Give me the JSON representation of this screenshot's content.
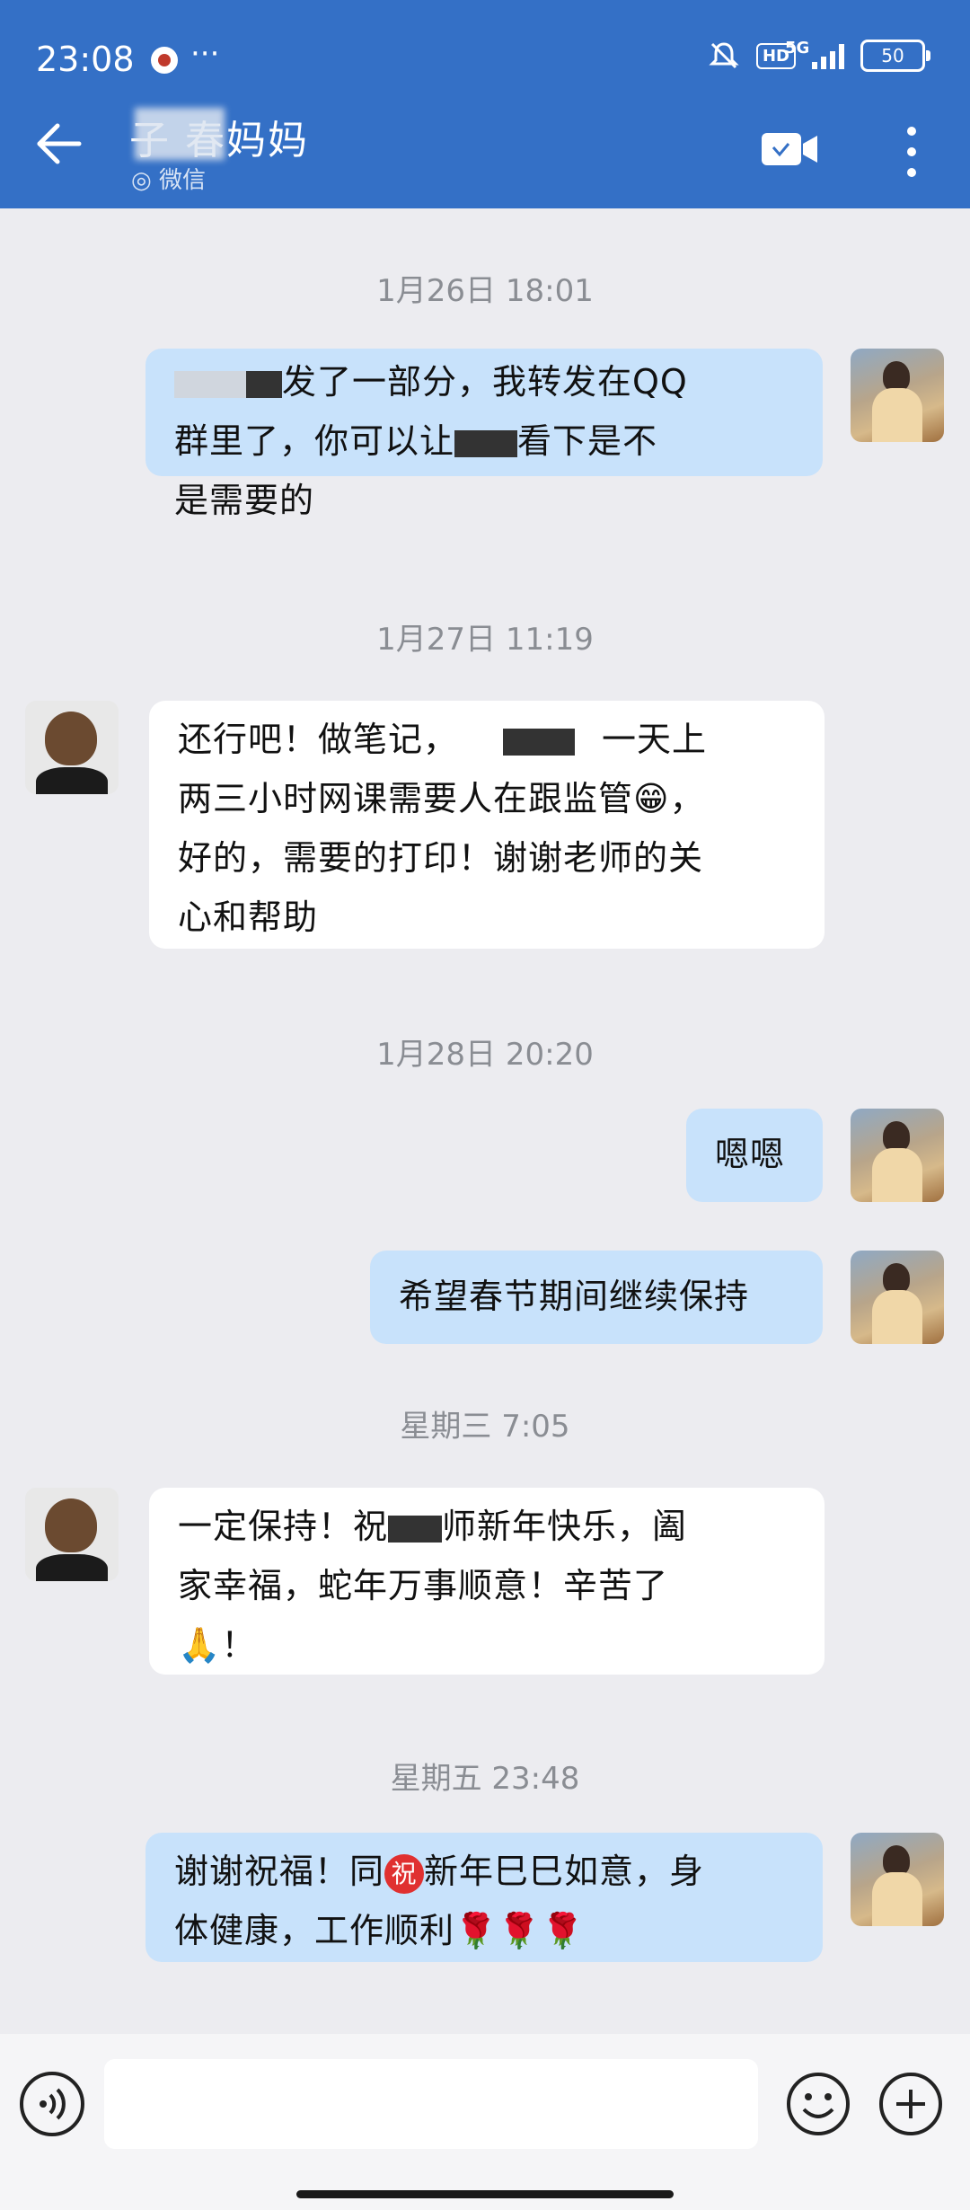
{
  "status_bar": {
    "time": "23:08",
    "dots": "···",
    "hd": "HD",
    "network": "5G",
    "battery": "50"
  },
  "header": {
    "title": "子  春妈妈",
    "subtitle": "微信"
  },
  "messages": [
    {
      "type": "timestamp",
      "text": "1月26日 18:01"
    },
    {
      "type": "me",
      "lines": [
        "发了一部分，我转发在QQ",
        "群里了，你可以让",
        "看下是不",
        "是需要的"
      ]
    },
    {
      "type": "timestamp",
      "text": "1月27日 11:19"
    },
    {
      "type": "other",
      "lines": [
        "还行吧！做笔记，",
        "一天上",
        "两三小时网课需要人在跟监管😁，",
        "好的，需要的打印！谢谢老师的关",
        "心和帮助"
      ]
    },
    {
      "type": "timestamp",
      "text": "1月28日 20:20"
    },
    {
      "type": "me",
      "lines": [
        "嗯嗯"
      ]
    },
    {
      "type": "me",
      "lines": [
        "希望春节期间继续保持"
      ]
    },
    {
      "type": "timestamp",
      "text": "星期三 7:05"
    },
    {
      "type": "other",
      "lines": [
        "一定保持！祝",
        "师新年快乐，阖",
        "家幸福，蛇年万事顺意！辛苦了",
        "🙏！"
      ]
    },
    {
      "type": "timestamp",
      "text": "星期五 23:48"
    },
    {
      "type": "me",
      "lines": [
        "谢谢祝福！同",
        "祝",
        "新年巳巳如意，身",
        "体健康，工作顺利🌹🌹🌹"
      ]
    }
  ]
}
